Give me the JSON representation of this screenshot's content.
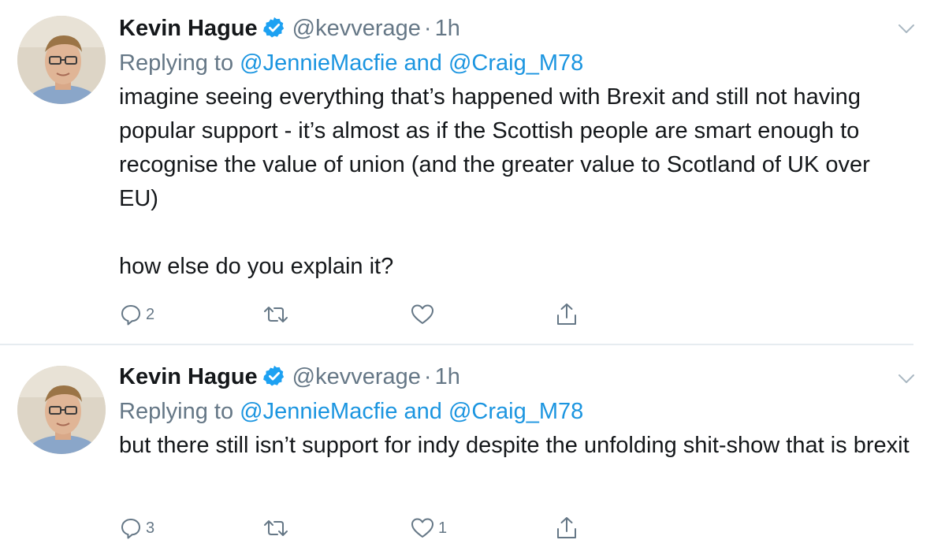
{
  "tweets": [
    {
      "name": "Kevin Hague",
      "handle": "@kevverage",
      "separator": "·",
      "time": "1h",
      "replying_prefix": "Replying to",
      "mention_1": "@JennieMacfie",
      "mention_joiner": "and",
      "mention_2": "@Craig_M78",
      "paragraphs": [
        "imagine seeing everything that’s happened with Brexit and still not having popular support - it’s almost as if the Scottish people are smart enough to recognise the value of union (and the greater value to Scotland of UK over EU)",
        "how else do you explain it?"
      ],
      "reply_count": "2",
      "retweet_count": "",
      "like_count": ""
    },
    {
      "name": "Kevin Hague",
      "handle": "@kevverage",
      "separator": "·",
      "time": "1h",
      "replying_prefix": "Replying to",
      "mention_1": "@JennieMacfie",
      "mention_joiner": "and",
      "mention_2": "@Craig_M78",
      "paragraphs": [
        "but there still isn’t support for indy despite the unfolding shit-show that is brexit"
      ],
      "reply_count": "3",
      "retweet_count": "",
      "like_count": "1"
    }
  ],
  "icons": {
    "verified": "verified-badge-icon",
    "caret": "chevron-down-icon",
    "reply": "reply-icon",
    "retweet": "retweet-icon",
    "like": "heart-icon",
    "share": "share-icon"
  },
  "colors": {
    "accent": "#1b95e0",
    "secondary_text": "#657786",
    "primary_text": "#14171a",
    "divider": "#e6ecf0"
  }
}
